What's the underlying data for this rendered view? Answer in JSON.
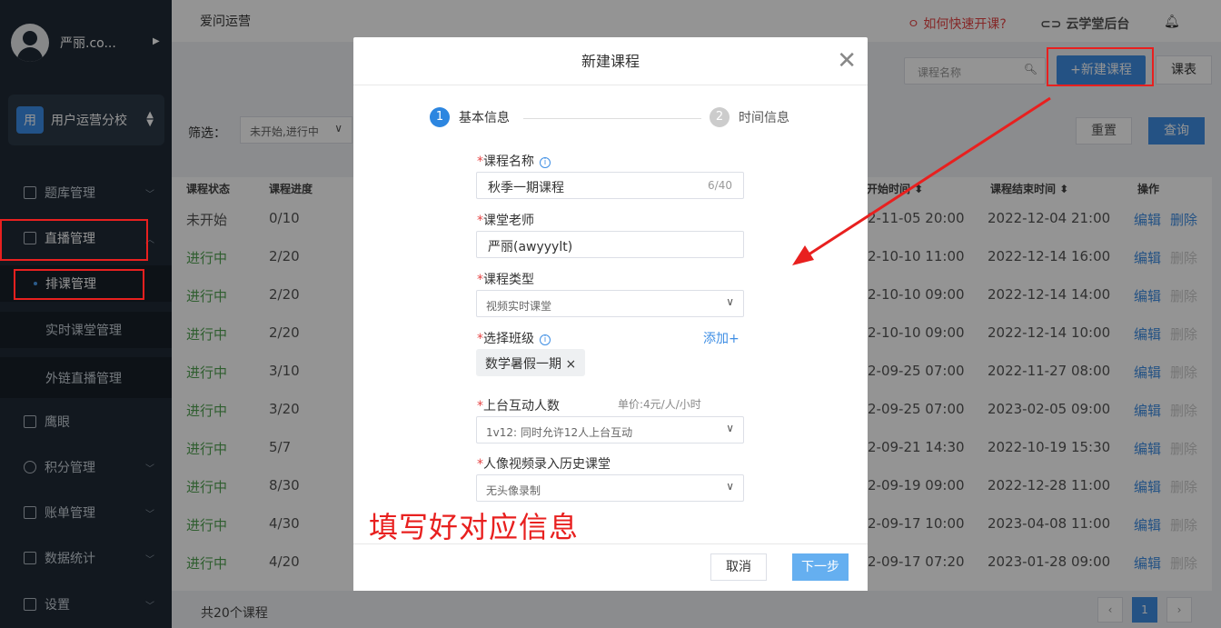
{
  "sidebar": {
    "user_name": "严丽.co...",
    "school_badge": "用",
    "school_name": "用户运营分校",
    "items": [
      {
        "label": "题库管理",
        "icon": "book-icon"
      },
      {
        "label": "直播管理",
        "icon": "tv-icon"
      },
      {
        "label": "排课管理"
      },
      {
        "label": "实时课堂管理"
      },
      {
        "label": "外链直播管理"
      },
      {
        "label": "鹰眼",
        "icon": "eye-icon"
      },
      {
        "label": "积分管理",
        "icon": "star-icon"
      },
      {
        "label": "账单管理",
        "icon": "bill-icon"
      },
      {
        "label": "数据统计",
        "icon": "chart-icon"
      },
      {
        "label": "设置",
        "icon": "grid-icon"
      }
    ]
  },
  "topbar": {
    "brand": "爱问运营",
    "howto": "如何快速开课?",
    "cloud": "云学堂后台"
  },
  "toolbar": {
    "search_placeholder": "课程名称",
    "new_course": "+新建课程",
    "schedule": "课表",
    "filter_label": "筛选：",
    "filter_value": "未开始,进行中",
    "reset": "重置",
    "query": "查询"
  },
  "table": {
    "headers": [
      "课程状态",
      "课程进度",
      "开始时间",
      "课程结束时间",
      "操作"
    ],
    "rows": [
      {
        "status": "未开始",
        "progress": "0/10",
        "start": "2-11-05 20:00",
        "end": "2022-12-04 21:00",
        "edit": "编辑",
        "del": "删除"
      },
      {
        "status": "进行中",
        "progress": "2/20",
        "start": "2-10-10 11:00",
        "end": "2022-12-14 16:00",
        "edit": "编辑",
        "del": "删除"
      },
      {
        "status": "进行中",
        "progress": "2/20",
        "start": "2-10-10 09:00",
        "end": "2022-12-14 14:00",
        "edit": "编辑",
        "del": "删除"
      },
      {
        "status": "进行中",
        "progress": "2/20",
        "start": "2-10-10 09:00",
        "end": "2022-12-14 10:00",
        "edit": "编辑",
        "del": "删除"
      },
      {
        "status": "进行中",
        "progress": "3/10",
        "start": "2-09-25 07:00",
        "end": "2022-11-27 08:00",
        "edit": "编辑",
        "del": "删除"
      },
      {
        "status": "进行中",
        "progress": "3/20",
        "start": "2-09-25 07:00",
        "end": "2023-02-05 09:00",
        "edit": "编辑",
        "del": "删除"
      },
      {
        "status": "进行中",
        "progress": "5/7",
        "start": "2-09-21 14:30",
        "end": "2022-10-19 15:30",
        "edit": "编辑",
        "del": "删除"
      },
      {
        "status": "进行中",
        "progress": "8/30",
        "start": "2-09-19 09:00",
        "end": "2022-12-28 11:00",
        "edit": "编辑",
        "del": "删除"
      },
      {
        "status": "进行中",
        "progress": "4/30",
        "start": "2-09-17 10:00",
        "end": "2023-04-08 11:00",
        "edit": "编辑",
        "del": "删除"
      },
      {
        "status": "进行中",
        "progress": "4/20",
        "start": "2-09-17 07:20",
        "end": "2023-01-28 09:00",
        "edit": "编辑",
        "del": "删除"
      }
    ],
    "total": "共20个课程",
    "page": "1"
  },
  "modal": {
    "title": "新建课程",
    "step1": "基本信息",
    "step2": "时间信息",
    "step1_num": "1",
    "step2_num": "2",
    "course_name_label": "课程名称",
    "course_name_value": "秋季一期课程",
    "course_name_count": "6/40",
    "teacher_label": "课堂老师",
    "teacher_value": "严丽(awyyylt)",
    "type_label": "课程类型",
    "type_value": "视频实时课堂",
    "class_label": "选择班级",
    "add_label": "添加+",
    "class_tag": "数学暑假一期",
    "interact_label": "上台互动人数",
    "price": "单价:4元/人/小时",
    "interact_value": "1v12:  同时允许12人上台互动",
    "record_label": "人像视频录入历史课堂",
    "record_value": "无头像录制",
    "cancel": "取消",
    "next": "下一步"
  },
  "annotation": "填写好对应信息",
  "colors": {
    "accent": "#3e8ee4",
    "annotation": "#e8201f",
    "sidebar": "#1f2a36"
  }
}
